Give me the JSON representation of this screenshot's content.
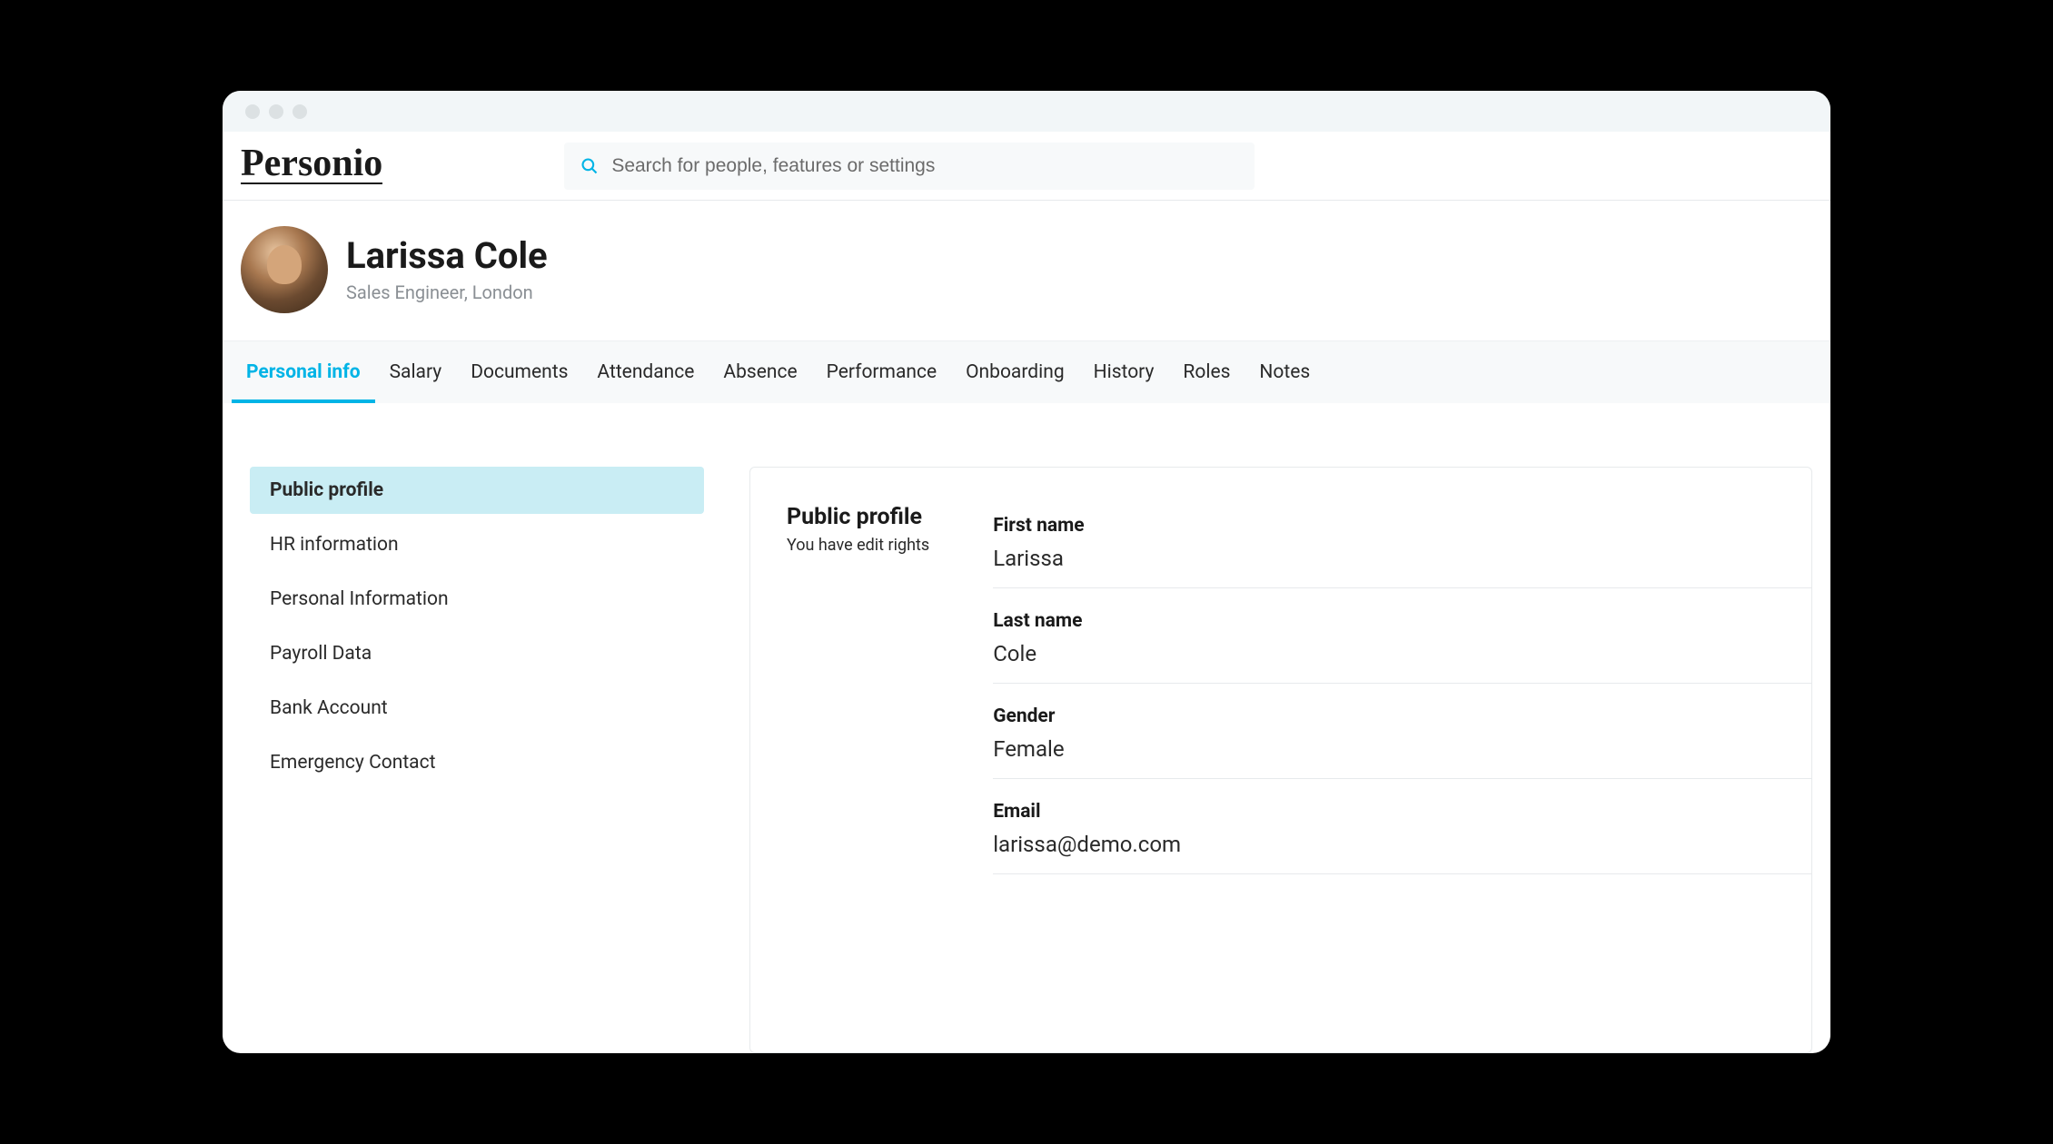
{
  "logo": "Personio",
  "search": {
    "placeholder": "Search for people, features or settings"
  },
  "profile": {
    "name": "Larissa Cole",
    "subtitle": "Sales Engineer, London"
  },
  "tabs": [
    {
      "label": "Personal info",
      "active": true
    },
    {
      "label": "Salary",
      "active": false
    },
    {
      "label": "Documents",
      "active": false
    },
    {
      "label": "Attendance",
      "active": false
    },
    {
      "label": "Absence",
      "active": false
    },
    {
      "label": "Performance",
      "active": false
    },
    {
      "label": "Onboarding",
      "active": false
    },
    {
      "label": "History",
      "active": false
    },
    {
      "label": "Roles",
      "active": false
    },
    {
      "label": "Notes",
      "active": false
    }
  ],
  "sidebar": {
    "items": [
      {
        "label": "Public profile",
        "active": true
      },
      {
        "label": "HR information",
        "active": false
      },
      {
        "label": "Personal Information",
        "active": false
      },
      {
        "label": "Payroll Data",
        "active": false
      },
      {
        "label": "Bank Account",
        "active": false
      },
      {
        "label": "Emergency Contact",
        "active": false
      }
    ]
  },
  "panel": {
    "title": "Public profile",
    "subtitle": "You have edit rights",
    "fields": [
      {
        "label": "First name",
        "value": "Larissa"
      },
      {
        "label": "Last name",
        "value": "Cole"
      },
      {
        "label": "Gender",
        "value": "Female"
      },
      {
        "label": "Email",
        "value": "larissa@demo.com"
      }
    ]
  }
}
